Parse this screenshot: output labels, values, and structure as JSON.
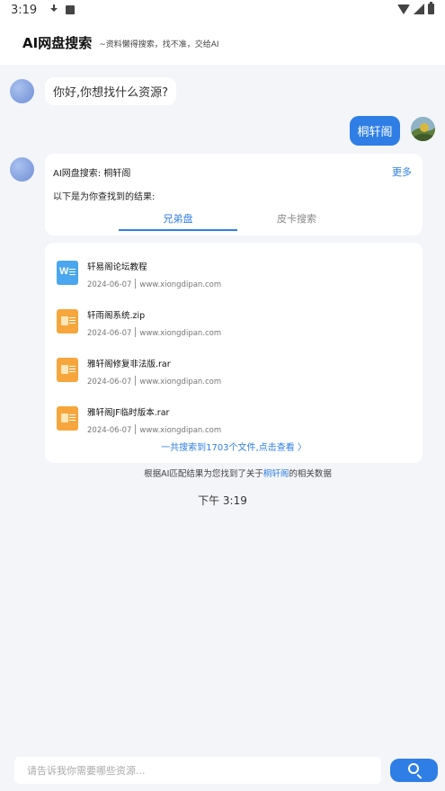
{
  "status_bar": {
    "time": "3:19"
  },
  "header": {
    "title": "AI网盘搜索",
    "subtitle": "~资料懒得搜索，找不准，交给AI"
  },
  "chat": {
    "greeting": "你好,你想找什么资源?",
    "user_query": "桐轩阁",
    "result_title": "AI网盘搜索: 桐轩阁",
    "more_label": "更多",
    "result_subtitle": "以下是为你查找到的结果:",
    "tabs": [
      {
        "label": "兄弟盘"
      },
      {
        "label": "皮卡搜索"
      }
    ],
    "files": [
      {
        "name": "轩易阁论坛教程",
        "date": "2024-06-07",
        "source": "www.xiongdipan.com",
        "icon": "word-file-icon"
      },
      {
        "name": "轩雨阁系统.zip",
        "date": "2024-06-07",
        "source": "www.xiongdipan.com",
        "icon": "archive-file-icon"
      },
      {
        "name": "雅轩阁修复非法版.rar",
        "date": "2024-06-07",
        "source": "www.xiongdipan.com",
        "icon": "archive-file-icon"
      },
      {
        "name": "雅轩阁JF临时版本.rar",
        "date": "2024-06-07",
        "source": "www.xiongdipan.com",
        "icon": "archive-file-icon"
      }
    ],
    "total_link": "一共搜索到1703个文件,点击查看 〉",
    "footnote_prefix": "根据AI匹配结果为您找到了关于",
    "footnote_keyword": "桐轩阁",
    "footnote_suffix": "的相关数据",
    "timestamp": "下午 3:19"
  },
  "input": {
    "placeholder": "请告诉我你需要哪些资源..."
  },
  "colors": {
    "accent": "#2f7ee6",
    "background": "#f4f5f9"
  }
}
